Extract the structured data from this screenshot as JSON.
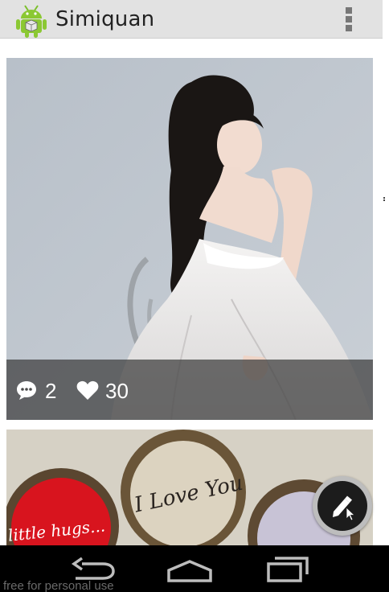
{
  "app": {
    "title": "Simiquan"
  },
  "actionbar": {
    "logo_icon": "android-robot-icon",
    "overflow_icon": "overflow-menu-icon"
  },
  "feed": {
    "posts": [
      {
        "image": "photo-woman-white-dress",
        "comments": "2",
        "likes": "30",
        "comment_icon": "comment-bubble-icon",
        "like_icon": "heart-icon"
      },
      {
        "image": "photo-bottle-caps",
        "caption_art": [
          "little hugs...",
          "I Love You"
        ]
      }
    ]
  },
  "fab": {
    "icon": "pencil-edit-icon"
  },
  "navbar": {
    "back_icon": "back-icon",
    "home_icon": "home-icon",
    "recents_icon": "recents-icon"
  },
  "watermark": "free for personal use",
  "colors": {
    "actionbar": "#e2e2e2",
    "stats_overlay": "#3c3c3c",
    "fab": "#1c1c1c",
    "navbar": "#000000"
  }
}
